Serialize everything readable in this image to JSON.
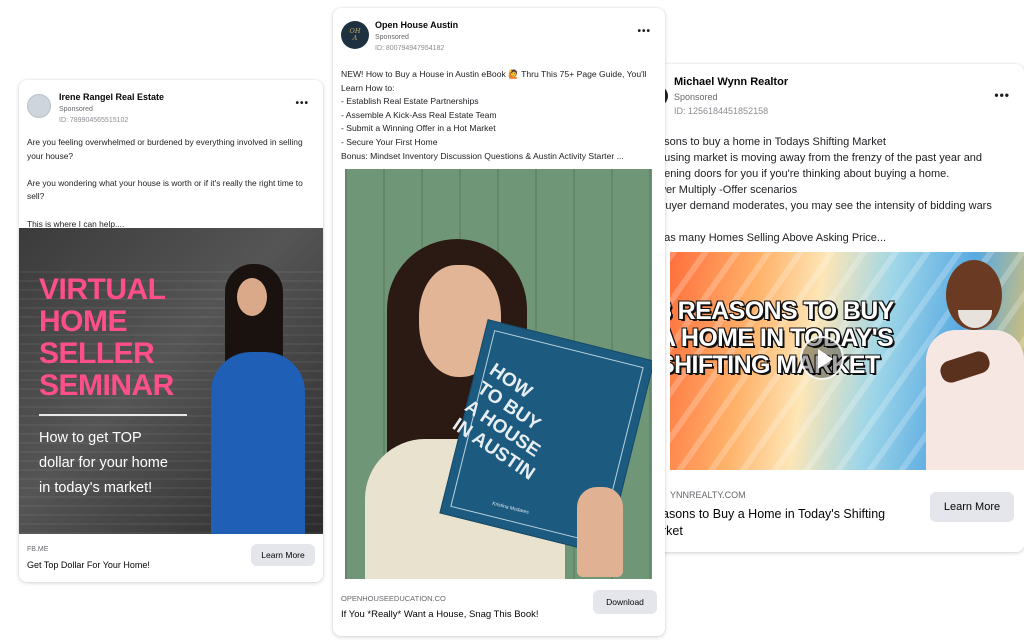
{
  "ads": [
    {
      "advertiser": "Irene Rangel Real Estate",
      "sponsored": "Sponsored",
      "ad_id": "ID: 789904565515102",
      "more_icon": "more-horizontal-icon",
      "body": "Are you feeling overwhelmed or burdened by everything involved in selling your house?\n\nAre you wondering what your house is worth or if it's really the right time to sell?\n\nThis is where I can help....",
      "creative": {
        "headline": "VIRTUAL\nHOME\nSELLER\nSEMINAR",
        "subheadline": "How to get TOP\ndollar for your home\nin today's market!",
        "accent_color": "#ff4f8b"
      },
      "link_domain": "FB.ME",
      "link_title": "Get Top Dollar For Your Home!",
      "cta": "Learn More"
    },
    {
      "advertiser": "Open House Austin",
      "sponsored": "Sponsored",
      "ad_id": "ID: 800794947954182",
      "more_icon": "more-horizontal-icon",
      "body": "NEW! How to Buy a House in Austin eBook 🙋 Thru This 75+ Page Guide, You'll Learn How to:\n- Establish Real Estate Partnerships\n- Assemble A Kick-Ass Real Estate Team\n- Submit a Winning Offer in a Hot Market\n- Secure Your First Home\nBonus: Mindset Inventory Discussion Questions & Austin Activity Starter ...",
      "creative": {
        "book_title": "HOW\nTO BUY\nA HOUSE\nIN AUSTIN",
        "book_author": "Kristina Modares",
        "book_color": "#1c5b7f"
      },
      "link_domain": "OPENHOUSEEDUCATION.CO",
      "link_title": "If You *Really* Want a House, Snag This Book!",
      "cta": "Download"
    },
    {
      "advertiser": "Michael Wynn Realtor",
      "sponsored": "Sponsored",
      "ad_id": "ID: 1256184451852158",
      "more_icon": "more-horizontal-icon",
      "body": "asons to buy a home in Todays Shifting Market\nousing market is moving away from the frenzy of the past year and\npening doors for you if you're thinking about buying a home.\nwer Multiply -Offer scenarios\nBuyer demand moderates, you may see the intensity of bidding wars\n\nt as many Homes Selling Above Asking Price...",
      "creative": {
        "headline": "3 REASONS TO BUY\nA HOME IN TODAY'S\nSHIFTING MARKET",
        "play_icon": "play-icon"
      },
      "link_domain": "YNNREALTY.COM",
      "link_title": "asons to Buy a Home in Today's Shifting\nrket",
      "cta": "Learn More"
    }
  ]
}
